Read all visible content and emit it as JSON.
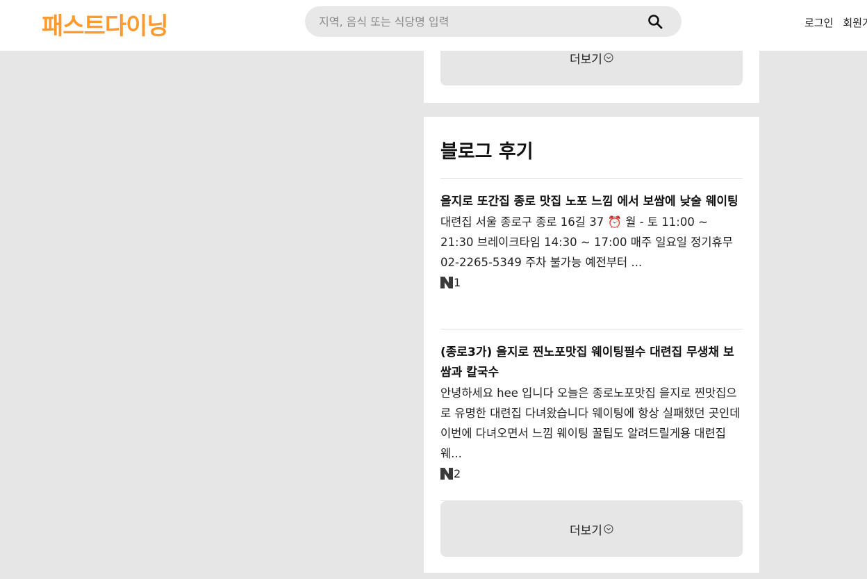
{
  "header": {
    "logo": "패스트다이닝",
    "search_placeholder": "지역, 음식 또는 식당명 입력",
    "login": "로그인",
    "signup": "회원가입"
  },
  "top_card": {
    "more_label": "더보기"
  },
  "blog": {
    "section_title": "블로그 후기",
    "posts": [
      {
        "title": "을지로 또간집 종로 맛집 노포 느낌 에서 보쌈에 낮술 웨이팅",
        "body_before_icon": "대련집 서울 종로구 종로 16길 37 ",
        "alarm_icon": "⏰",
        "body_after_icon": " 월 - 토 11:00 ~ 21:30 브레이크타임 14:30 ~ 17:00 매주 일요일 정기휴무 02-2265-5349 주차 불가능 예전부터 ...",
        "source_icon": "naver-n-icon",
        "rank": "1"
      },
      {
        "title": "(종로3가) 을지로 찐노포맛집 웨이팅필수 대련집 무생채 보쌈과 칼국수",
        "body": "안녕하세요 hee 입니다 오늘은 종로노포맛집 을지로 찐맛집으로 유명한 대련집 다녀왔습니다 웨이팅에 항상 실패했던 곳인데 이번에 다녀오면서 느낌 웨이팅 꿀팁도 알려드릴게용 대련집 웨...",
        "source_icon": "naver-n-icon",
        "rank": "2"
      }
    ],
    "more_label": "더보기"
  },
  "colors": {
    "brand": "#ff9a2e",
    "background": "#e6e6e6",
    "button_bg": "#e6e6e6"
  }
}
